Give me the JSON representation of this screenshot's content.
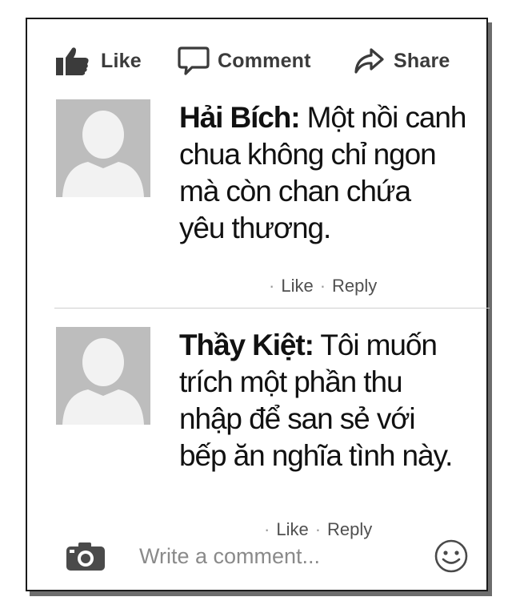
{
  "actions": {
    "like": {
      "label": "Like",
      "icon": "thumbs-up-icon"
    },
    "comment": {
      "label": "Comment",
      "icon": "speech-bubble-icon"
    },
    "share": {
      "label": "Share",
      "icon": "share-arrow-icon"
    }
  },
  "comments": [
    {
      "author": "Hải Bích:",
      "lines": [
        "Một nồi canh",
        "chua không chỉ ngon",
        "mà còn chan chứa",
        "yêu thương."
      ],
      "like_label": "Like",
      "reply_label": "Reply",
      "avatar_icon": "default-avatar-icon"
    },
    {
      "author": "Thầy Kiệt:",
      "lines": [
        "Tôi muốn",
        "trích một phần thu",
        "nhập để san sẻ với",
        "bếp ăn nghĩa tình này."
      ],
      "like_label": "Like",
      "reply_label": "Reply",
      "avatar_icon": "default-avatar-icon"
    }
  ],
  "composer": {
    "placeholder": "Write a comment...",
    "camera_icon": "camera-icon",
    "emoji_icon": "smiley-icon"
  },
  "colors": {
    "avatar_bg": "#bdbdbd",
    "avatar_figure": "#f2f2f2",
    "icon_gray": "#3b3b3b",
    "placeholder_gray": "#8a8a8a"
  }
}
